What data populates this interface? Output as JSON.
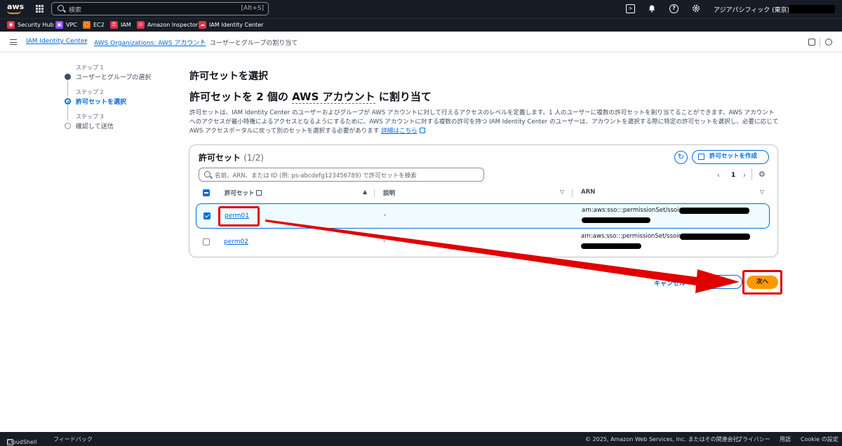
{
  "topbar": {
    "logo": "aws",
    "search_placeholder": "検索",
    "search_shortcut": "[Alt+S]",
    "region": "アジアパシフィック (東京) ▾",
    "icons": [
      "cloudshell-icon",
      "bell-icon",
      "help-icon",
      "settings-icon"
    ]
  },
  "favorites": [
    {
      "label": "Security Hub",
      "color": "#dd344c"
    },
    {
      "label": "VPC",
      "color": "#8c4fff"
    },
    {
      "label": "EC2",
      "color": "#ed7100"
    },
    {
      "label": "IAM",
      "color": "#dd344c"
    },
    {
      "label": "Amazon Inspector",
      "color": "#dd344c"
    },
    {
      "label": "IAM Identity Center",
      "color": "#dd344c"
    }
  ],
  "breadcrumb": {
    "items": [
      "IAM Identity Center",
      "AWS Organizations: AWS アカウント"
    ],
    "current": "ユーザーとグループの割り当て"
  },
  "steps": [
    {
      "number": "ステップ 1",
      "label": "ユーザーとグループの選択",
      "state": "done"
    },
    {
      "number": "ステップ 2",
      "label": "許可セットを選択",
      "state": "current"
    },
    {
      "number": "ステップ 3",
      "label": "確認して送信",
      "state": "pending"
    }
  ],
  "page": {
    "title": "許可セットを選択",
    "subtitle_pre": "許可セットを 2 個の ",
    "subtitle_link": "AWS アカウント",
    "subtitle_post": " に割り当て",
    "description": "許可セットは、IAM Identity Center のユーザーおよびグループが AWS アカウントに対して行えるアクセスのレベルを定義します。1 人のユーザーに複数の許可セットを割り当てることができます。AWS アカウントへのアクセスが最小特権によるアクセスとなるようにするために、AWS アカウントに対する複数の許可を持つ IAM Identity Center のユーザーは、アカウントを選択する際に特定の許可セットを選択し、必要に応じて AWS アクセスポータルに戻って別のセットを選択する必要があります",
    "learn_more": "詳細はこちら"
  },
  "panel": {
    "title": "許可セット",
    "count": "(1/2)",
    "create_label": "許可セットを作成",
    "filter_placeholder": "名前、ARN、または ID (例: ps-abcdefg123456789) で許可セットを検索",
    "page_number": "1",
    "columns": [
      "許可セット",
      "説明",
      "ARN"
    ],
    "rows": [
      {
        "name": "perm01",
        "description": "-",
        "arn": "arn:aws:sso:::permissionSet/ssoins-",
        "selected": true
      },
      {
        "name": "perm02",
        "description": "-",
        "arn": "arn:aws:sso:::permissionSet/ssoins-",
        "selected": false
      }
    ]
  },
  "actions": {
    "cancel": "キャンセル",
    "next": "次へ"
  },
  "footer": {
    "cloudshell": "CloudShell",
    "feedback": "フィードバック",
    "copyright": "© 2025, Amazon Web Services, Inc. またはその関連会社。",
    "privacy": "プライバシー",
    "terms": "用語",
    "cookie": "Cookie の設定"
  },
  "colors": {
    "accent": "#006ce0",
    "primary_button": "#ff9900",
    "annotation": "#e00000",
    "nav_bg": "#161d26"
  }
}
